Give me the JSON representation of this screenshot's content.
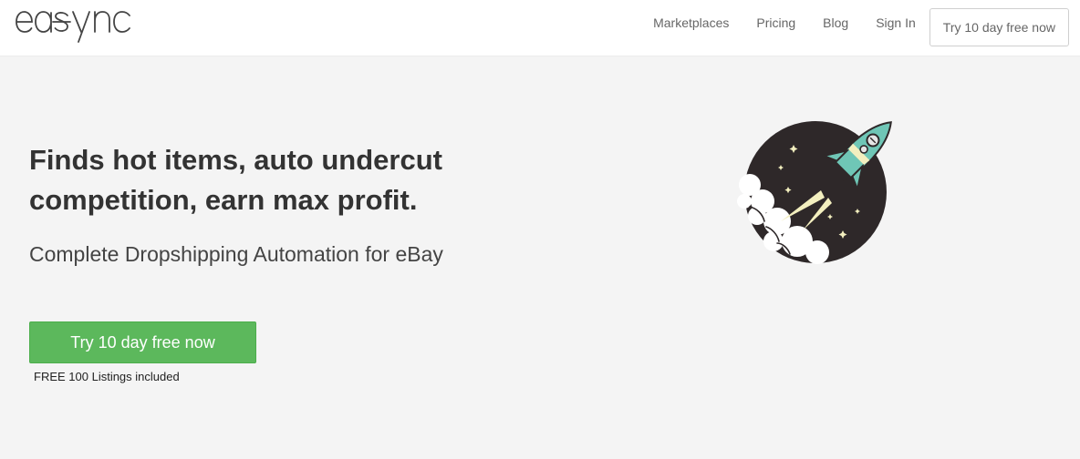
{
  "brand": {
    "logo_text": "easync"
  },
  "nav": {
    "links": [
      {
        "label": "Marketplaces"
      },
      {
        "label": "Pricing"
      },
      {
        "label": "Blog"
      },
      {
        "label": "Sign In"
      }
    ],
    "cta_label": "Try 10 day free now"
  },
  "hero": {
    "title": "Finds hot items, auto undercut competition, earn max profit.",
    "subtitle": "Complete Dropshipping Automation for eBay",
    "cta_label": "Try 10 day free now",
    "note": "FREE 100 Listings included",
    "illustration": "rocket-launch"
  },
  "colors": {
    "page_background": "#f4f4f4",
    "header_background": "#ffffff",
    "cta_green": "#5cb85c",
    "text_dark": "#333333",
    "rocket_teal": "#6fc6b6",
    "rocket_cream": "#f3efbf",
    "rocket_dark": "#2e2829"
  }
}
